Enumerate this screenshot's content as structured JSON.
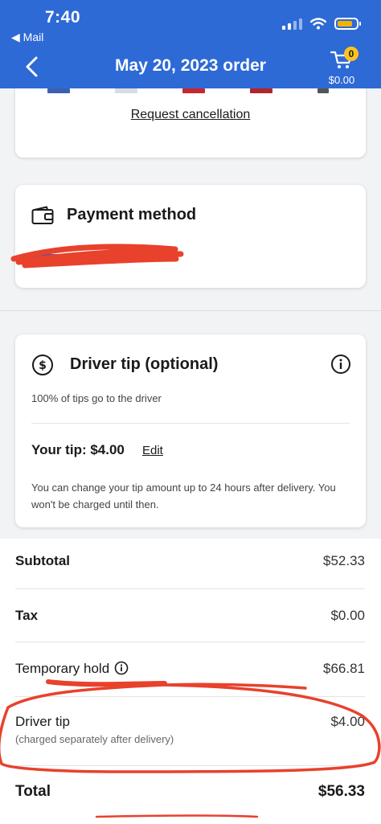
{
  "status_bar": {
    "time": "7:40",
    "back_app": "◀ Mail"
  },
  "header": {
    "title": "May 20, 2023 order",
    "cart_count": "0",
    "cart_total": "$0.00"
  },
  "items_card": {
    "request_cancellation": "Request cancellation"
  },
  "payment": {
    "title": "Payment method"
  },
  "tip_card": {
    "title": "Driver tip (optional)",
    "note": "100% of tips go to the driver",
    "your_tip": "Your tip: $4.00",
    "edit": "Edit",
    "help": "You can change your tip amount up to 24 hours after delivery. You won't be charged until then."
  },
  "summary": {
    "subtotal_label": "Subtotal",
    "subtotal_value": "$52.33",
    "tax_label": "Tax",
    "tax_value": "$0.00",
    "hold_label": "Temporary hold",
    "hold_value": "$66.81",
    "driver_tip_label": "Driver tip",
    "driver_tip_value": "$4.00",
    "driver_tip_sub": "(charged separately after delivery)",
    "total_label": "Total",
    "total_value": "$56.33"
  },
  "colors": {
    "brand_blue": "#2e6ad6",
    "badge_yellow": "#ffc220",
    "annotation_red": "#e8412c"
  },
  "icons": [
    "back-arrow-icon",
    "cart-icon",
    "wallet-icon",
    "dollar-icon",
    "info-icon",
    "signal-icon",
    "wifi-icon",
    "battery-icon"
  ]
}
